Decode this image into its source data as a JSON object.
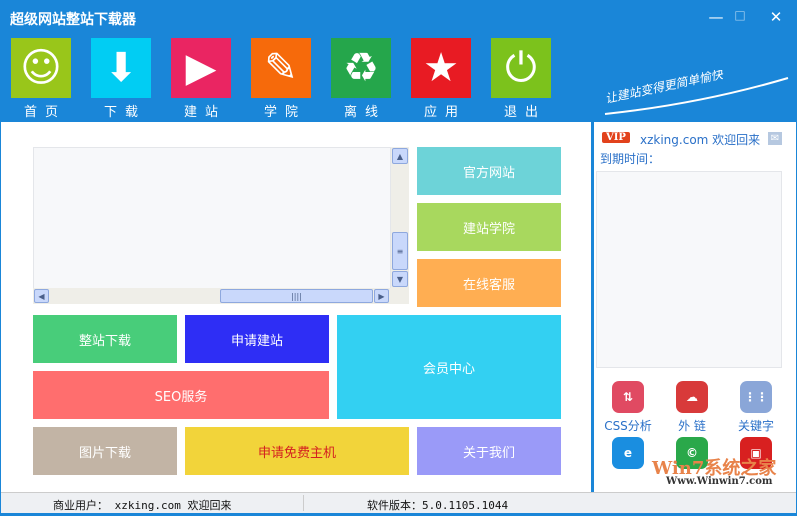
{
  "window": {
    "title": "超级网站整站下载器",
    "minimize": "—",
    "maximize": "□",
    "close": "✕"
  },
  "nav": [
    {
      "label": "首页",
      "icon": "smiley-icon",
      "color": "#99c61a"
    },
    {
      "label": "下载",
      "icon": "download-arrow-icon",
      "color": "#01cdf3"
    },
    {
      "label": "建站",
      "icon": "play-icon",
      "color": "#ea2562"
    },
    {
      "label": "学院",
      "icon": "pencil-icon",
      "color": "#f66a0b"
    },
    {
      "label": "离线",
      "icon": "recycle-icon",
      "color": "#25a64b"
    },
    {
      "label": "应用",
      "icon": "star-icon",
      "color": "#e81b23"
    },
    {
      "label": "退出",
      "icon": "power-icon",
      "color": "#7cc21c"
    }
  ],
  "slogan": "让建站变得更简单愉快",
  "tiles": {
    "official": "官方网站",
    "academy": "建站学院",
    "service": "在线客服",
    "site_download": "整站下载",
    "apply_build": "申请建站",
    "member": "会员中心",
    "seo": "SEO服务",
    "image_download": "图片下载",
    "free_host": "申请免费主机",
    "about": "关于我们"
  },
  "user": {
    "vip": "VIP",
    "welcome": "xzking.com 欢迎回来",
    "expire_label": "到期时间："
  },
  "tools": [
    {
      "label": "CSS分析",
      "icon": "css-arrows-icon"
    },
    {
      "label": "外 链",
      "icon": "cloud-upload-icon"
    },
    {
      "label": "关键字",
      "icon": "grid-icon"
    },
    {
      "label": "",
      "icon": "ie-icon"
    },
    {
      "label": "",
      "icon": "bittorrent-icon"
    },
    {
      "label": "",
      "icon": "toolbox-icon"
    }
  ],
  "watermark": {
    "brand": "Win7系统之家",
    "url": "Www.Winwin7.com"
  },
  "status": {
    "user": "商业用户： xzking.com  欢迎回来",
    "version": "软件版本：5.0.1105.1044"
  }
}
